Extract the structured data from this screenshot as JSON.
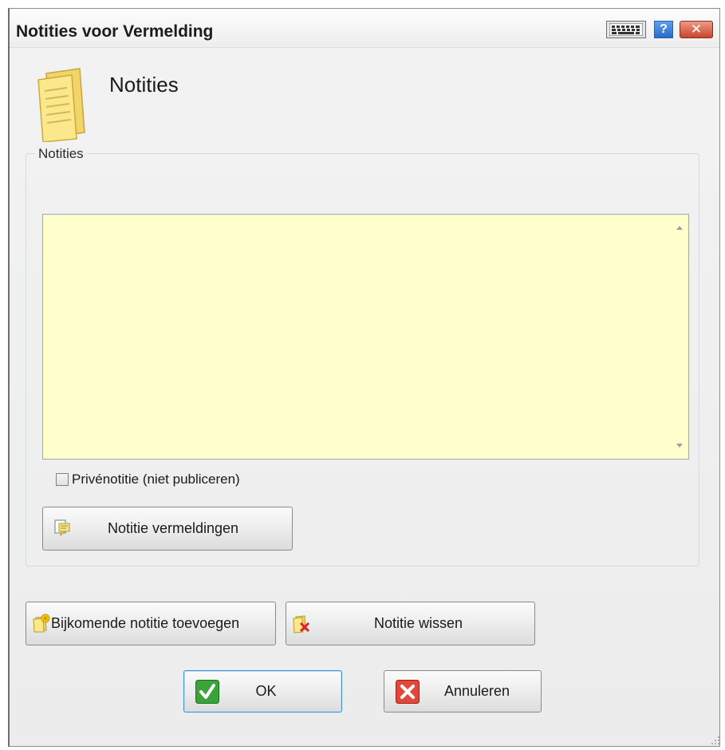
{
  "window": {
    "title": "Notities voor Vermelding",
    "help_label": "?",
    "close_label": "✕"
  },
  "header": {
    "title": "Notities"
  },
  "notes_group": {
    "legend": "Notities",
    "text_value": "",
    "private_checkbox": {
      "label": "Privénotitie (niet publiceren)",
      "checked": false
    },
    "vermeldingen_button": "Notitie vermeldingen"
  },
  "actions": {
    "add_note": "Bijkomende notitie toevoegen",
    "delete_note": "Notitie wissen"
  },
  "dialog_buttons": {
    "ok": "OK",
    "cancel": "Annuleren"
  },
  "colors": {
    "notes_background": "#ffffcc",
    "ok_accent": "#3a8fc9",
    "close_red": "#c9452b",
    "help_blue": "#2a6cc6"
  }
}
